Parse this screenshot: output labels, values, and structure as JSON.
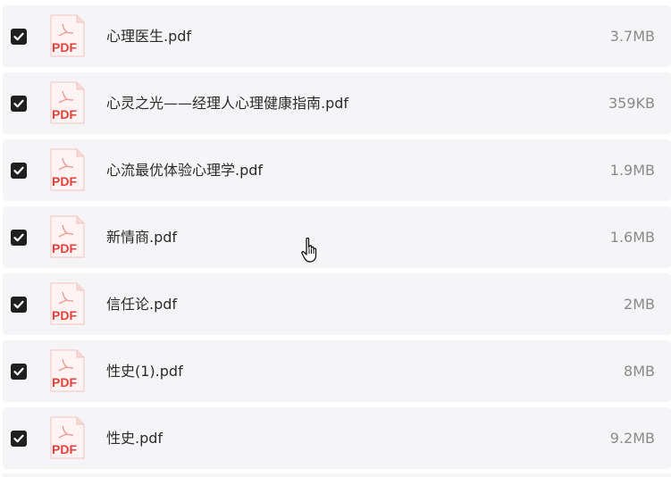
{
  "files": [
    {
      "name": "心理医生.pdf",
      "size": "3.7MB",
      "checked": true,
      "icon": "pdf-icon"
    },
    {
      "name": "心灵之光——经理人心理健康指南.pdf",
      "size": "359KB",
      "checked": true,
      "icon": "pdf-icon"
    },
    {
      "name": "心流最优体验心理学.pdf",
      "size": "1.9MB",
      "checked": true,
      "icon": "pdf-icon"
    },
    {
      "name": "新情商.pdf",
      "size": "1.6MB",
      "checked": true,
      "icon": "pdf-icon"
    },
    {
      "name": "信任论.pdf",
      "size": "2MB",
      "checked": true,
      "icon": "pdf-icon"
    },
    {
      "name": "性史(1).pdf",
      "size": "8MB",
      "checked": true,
      "icon": "pdf-icon"
    },
    {
      "name": "性史.pdf",
      "size": "9.2MB",
      "checked": true,
      "icon": "pdf-icon"
    }
  ],
  "pdf_icon_label": "PDF",
  "colors": {
    "row_background": "#f5f5f7",
    "checkbox": "#1f1f1f",
    "pdf_red": "#e5403a",
    "size_text": "#8a8a8a"
  }
}
